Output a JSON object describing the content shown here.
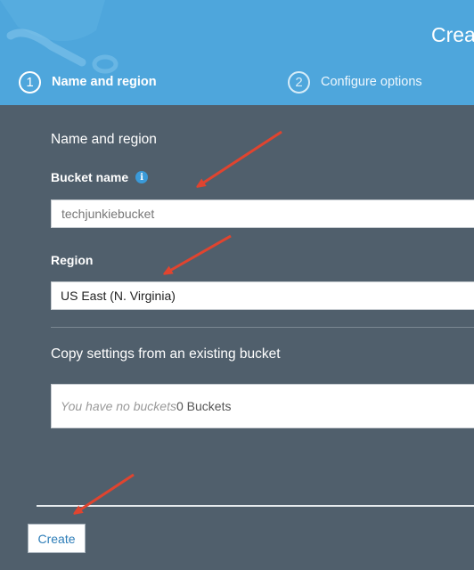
{
  "header": {
    "title": "Creat",
    "steps": [
      {
        "number": "1",
        "label": "Name and region"
      },
      {
        "number": "2",
        "label": "Configure options"
      }
    ]
  },
  "form": {
    "section_title": "Name and region",
    "bucket_name": {
      "label": "Bucket name",
      "value": "techjunkiebucket"
    },
    "region": {
      "label": "Region",
      "selected": "US East (N. Virginia)"
    },
    "copy_settings": {
      "title": "Copy settings from an existing bucket",
      "empty_text": "You have no buckets",
      "count_text": "0 Buckets"
    }
  },
  "footer": {
    "create_label": "Create"
  },
  "colors": {
    "header_bg": "#4ea6dc",
    "page_bg": "#505f6c",
    "arrow": "#e0442f",
    "link_blue": "#2d7db8"
  }
}
